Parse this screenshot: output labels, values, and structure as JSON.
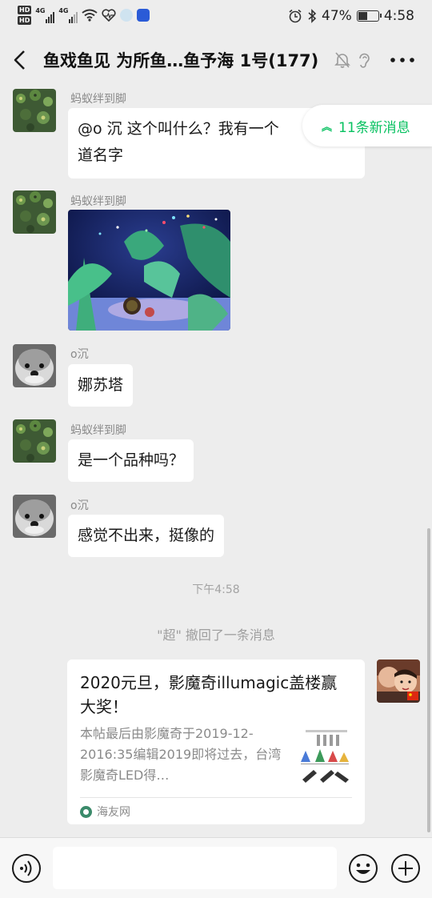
{
  "status_bar": {
    "hd1": "HD",
    "hd2": "HD",
    "net1": "4G",
    "net2": "4G",
    "battery_percent": "47%",
    "battery_level": 0.47,
    "time": "4:58",
    "icons": [
      "wifi-icon",
      "heartbeat-icon",
      "alarm-icon",
      "bluetooth-icon",
      "battery-icon"
    ]
  },
  "header": {
    "title": "鱼戏鱼见  为所鱼…鱼予海 1号(177)",
    "icons": [
      "back-icon",
      "mute-icon",
      "ear-icon",
      "more-icon"
    ]
  },
  "new_messages": {
    "label": "11条新消息"
  },
  "messages": [
    {
      "sender": "蚂蚁绊到脚",
      "text_line1": "@o 沉  这个叫什么？我有一个",
      "text_line2": "道名字"
    },
    {
      "sender": "蚂蚁绊到脚",
      "type": "image"
    },
    {
      "sender": "o沉",
      "text": "娜苏塔"
    },
    {
      "sender": "蚂蚁绊到脚",
      "text": "是一个品种吗？"
    },
    {
      "sender": "o沉",
      "text": "感觉不出来，挺像的"
    }
  ],
  "time_label": "下午4:58",
  "recall_label": "\"超\" 撤回了一条消息",
  "link_card": {
    "title": "2020元旦，影魔奇illumagic盖楼赢大奖！",
    "description": "本帖最后由影魔奇于2019-12-2016:35编辑2019即将过去，台湾影魔奇LED得…",
    "source": "海友网"
  },
  "input_bar": {
    "placeholder": "",
    "icons": [
      "voice-icon",
      "emoji-icon",
      "plus-icon"
    ]
  },
  "colors": {
    "background": "#ededed",
    "accent_green": "#07c160",
    "bubble": "#ffffff",
    "muted_text": "#8a8a8a"
  }
}
